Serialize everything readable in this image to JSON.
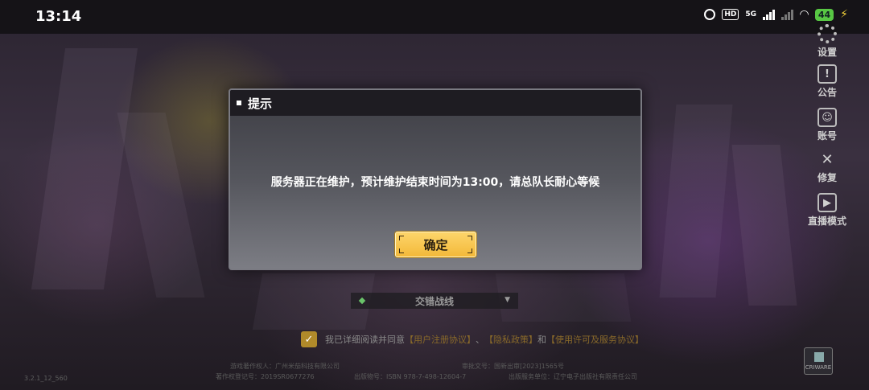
{
  "status_bar": {
    "time": "13:14",
    "network": "5G",
    "battery": "44",
    "hd": "HD"
  },
  "side_menu": {
    "items": [
      {
        "label": "设置",
        "icon": "gear-icon"
      },
      {
        "label": "公告",
        "icon": "notice-icon"
      },
      {
        "label": "账号",
        "icon": "account-icon"
      },
      {
        "label": "修复",
        "icon": "repair-icon"
      },
      {
        "label": "直播模式",
        "icon": "tv-icon"
      }
    ]
  },
  "dialog": {
    "title": "提示",
    "message": "服务器正在维护，预计维护结束时间为13:00，请总队长耐心等候",
    "confirm_label": "确定"
  },
  "server": {
    "name": "交错战线"
  },
  "agreement": {
    "prefix": "我已详细阅读并同意",
    "link1": "【用户注册协议】",
    "sep1": "、",
    "link2": "【隐私政策】",
    "sep2": "和",
    "link3": "【使用许可及服务协议】"
  },
  "footer": {
    "copyright_owner": "游戏著作权人：广州米茄科技有限公司",
    "approval": "审批文号：国新出审[2023]1565号",
    "registration": "著作权登记号：2019SR0677276",
    "isbn": "出版物号：ISBN 978-7-498-12604-7",
    "publisher": "出版服务单位：辽宁电子出版社有限责任公司",
    "version": "3.2.1_12_560",
    "logo": "CRIWARE"
  },
  "colors": {
    "accent": "#f3b93a",
    "dialog_header": "#1e1c22",
    "battery": "#58c744"
  }
}
